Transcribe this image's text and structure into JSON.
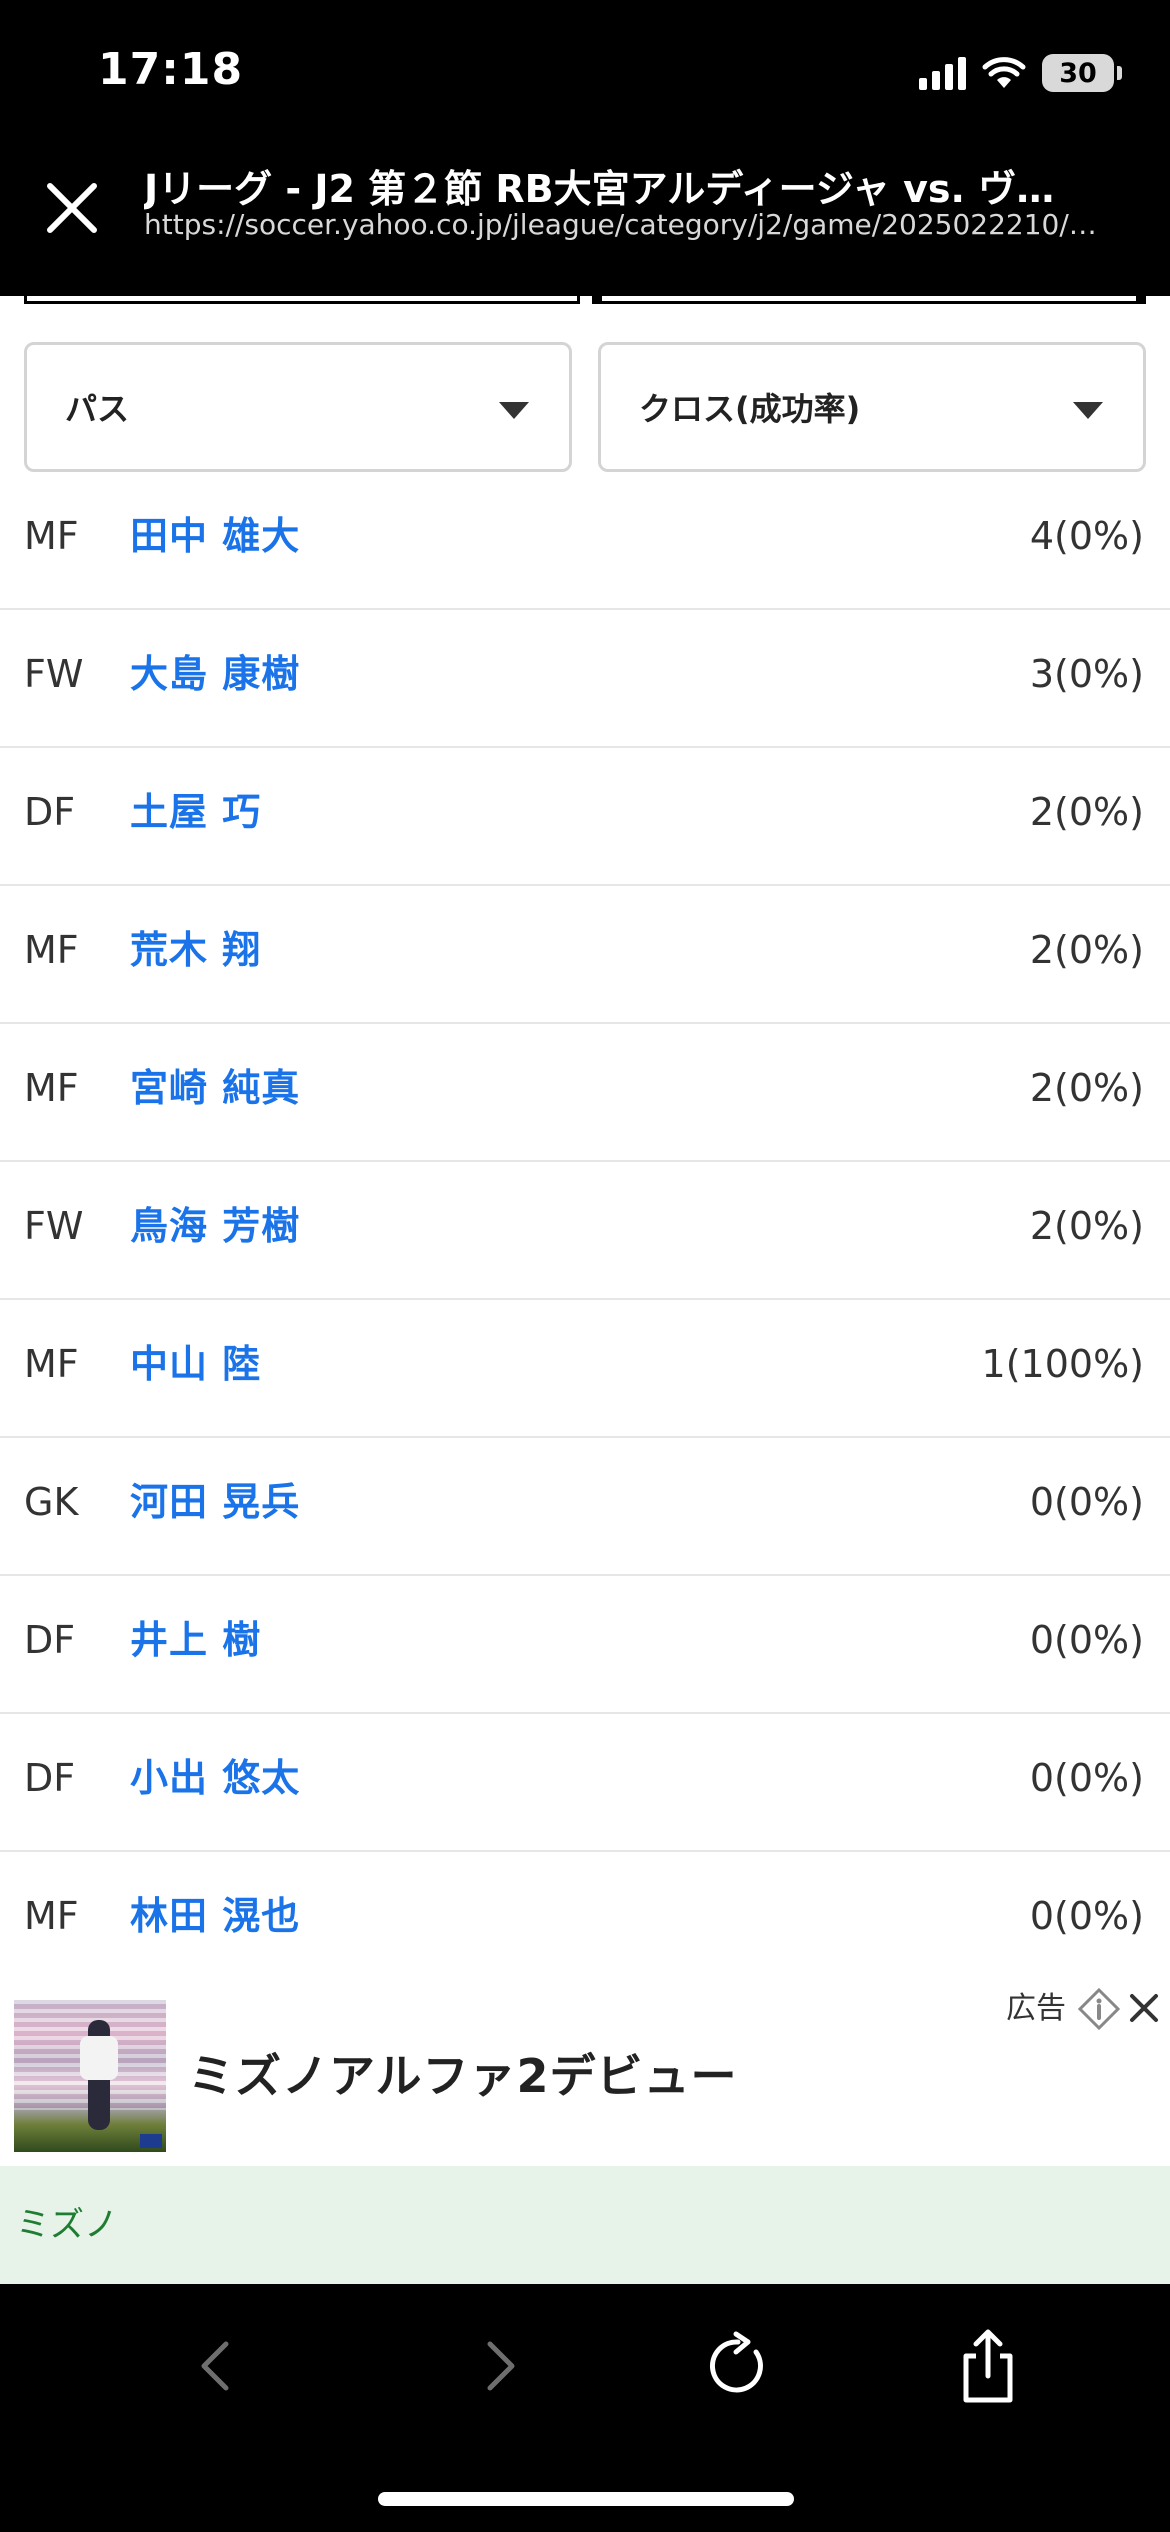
{
  "status_bar": {
    "time": "17:18",
    "battery": "30"
  },
  "browser": {
    "title": "Jリーグ - J2 第２節 RB大宮アルディージャ vs. ヴ…",
    "url": "https://soccer.yahoo.co.jp/jleague/category/j2/game/2025022210/…",
    "close_icon": "close-icon"
  },
  "filters": {
    "category": "パス",
    "metric": "クロス(成功率)"
  },
  "players": [
    {
      "pos": "MF",
      "name": "田中 雄大",
      "stat": "4(0%)"
    },
    {
      "pos": "FW",
      "name": "大島 康樹",
      "stat": "3(0%)"
    },
    {
      "pos": "DF",
      "name": "土屋 巧",
      "stat": "2(0%)"
    },
    {
      "pos": "MF",
      "name": "荒木 翔",
      "stat": "2(0%)"
    },
    {
      "pos": "MF",
      "name": "宮崎 純真",
      "stat": "2(0%)"
    },
    {
      "pos": "FW",
      "name": "鳥海 芳樹",
      "stat": "2(0%)"
    },
    {
      "pos": "MF",
      "name": "中山 陸",
      "stat": "1(100%)"
    },
    {
      "pos": "GK",
      "name": "河田 晃兵",
      "stat": "0(0%)"
    },
    {
      "pos": "DF",
      "name": "井上 樹",
      "stat": "0(0%)"
    },
    {
      "pos": "DF",
      "name": "小出 悠太",
      "stat": "0(0%)"
    },
    {
      "pos": "MF",
      "name": "林田 滉也",
      "stat": "0(0%)"
    }
  ],
  "ad": {
    "label": "広告",
    "headline": "ミズノアルファ2デビュー",
    "advertiser": "ミズノ"
  },
  "toolbar": {
    "back_icon": "chevron-left-icon",
    "forward_icon": "chevron-right-icon",
    "reload_icon": "reload-icon",
    "share_icon": "share-icon"
  },
  "colors": {
    "link_blue": "#1a73e8",
    "ad_footer_bg": "#e7f3e8",
    "ad_footer_text": "#1e7d32"
  }
}
